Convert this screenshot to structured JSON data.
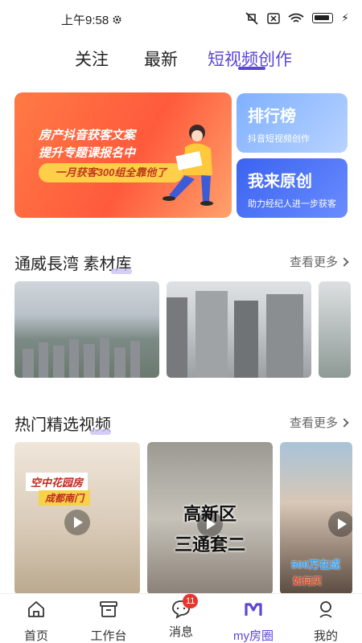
{
  "status_bar": {
    "time": "上午9:58",
    "icons": [
      "gear-icon",
      "mute-icon",
      "close-box-icon",
      "wifi-icon",
      "battery-icon",
      "charging-icon"
    ]
  },
  "top_tabs": [
    {
      "label": "关注",
      "active": false
    },
    {
      "label": "最新",
      "active": false
    },
    {
      "label": "短视频创作",
      "active": true
    }
  ],
  "banners": {
    "main": {
      "line1": "房产抖音获客文案",
      "line2": "提升专题课报名中",
      "pill": "一月获客300组全靠他了"
    },
    "rank": {
      "title": "排行榜",
      "subtitle": "抖音短视频创作"
    },
    "original": {
      "title": "我来原创",
      "subtitle": "助力经纪人进一步获客"
    }
  },
  "material_section": {
    "title": "通威長湾 素材库",
    "see_more": "查看更多"
  },
  "hot_section": {
    "title": "热门精选视频",
    "see_more": "查看更多"
  },
  "videos": [
    {
      "caption1": "空中花园房",
      "caption2": "成都南门"
    },
    {
      "caption1": "高新区",
      "caption2": "三通套二"
    },
    {
      "caption1": "500万在成",
      "caption2": "如何买"
    }
  ],
  "bottom_nav": [
    {
      "label": "首页",
      "icon": "home-icon",
      "active": false
    },
    {
      "label": "工作台",
      "icon": "workbench-icon",
      "active": false
    },
    {
      "label": "消息",
      "icon": "message-icon",
      "active": false,
      "badge": "11"
    },
    {
      "label": "my房圈",
      "icon": "m-logo-icon",
      "active": true
    },
    {
      "label": "我的",
      "icon": "profile-icon",
      "active": false
    }
  ],
  "colors": {
    "accent": "#5b46d6",
    "badge": "#e8342d",
    "banner_orange": "#ff5a3c",
    "banner_blue": "#3a63f0"
  }
}
